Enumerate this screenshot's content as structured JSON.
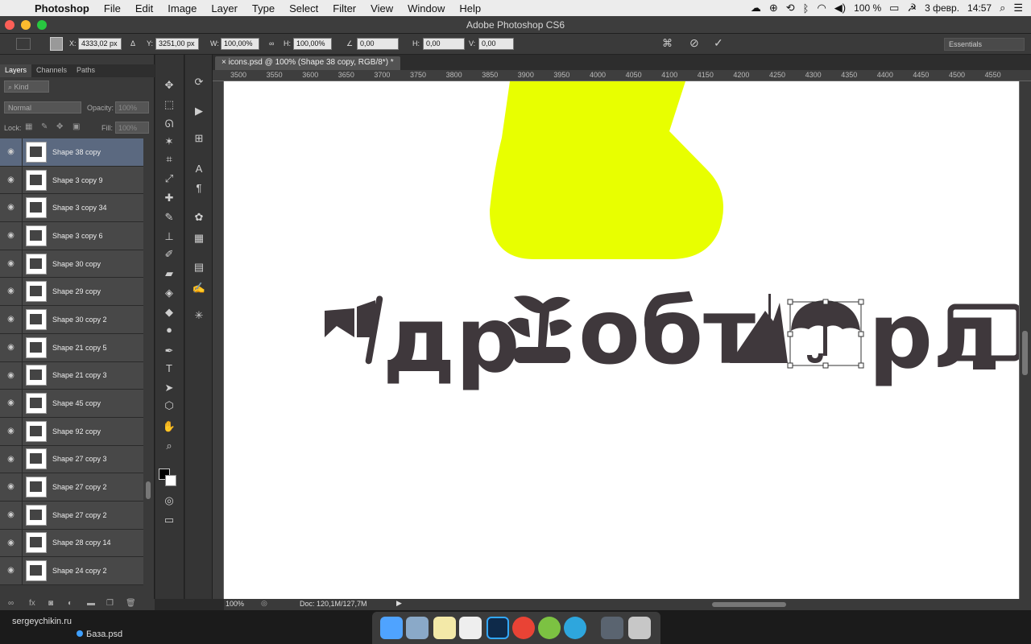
{
  "menubar": {
    "app": "Photoshop",
    "items": [
      "File",
      "Edit",
      "Image",
      "Layer",
      "Type",
      "Select",
      "Filter",
      "View",
      "Window",
      "Help"
    ],
    "battery": "100 %",
    "date": "3 февр.",
    "time": "14:57"
  },
  "window": {
    "title": "Adobe Photoshop CS6"
  },
  "options": {
    "x_label": "X:",
    "x_value": "4333,02 px",
    "y_label": "Y:",
    "y_value": "3251,00 px",
    "w_label": "W:",
    "w_value": "100,00%",
    "h_label": "H:",
    "h_value": "100,00%",
    "angle_value": "0,00",
    "hskew_label": "H:",
    "hskew_value": "0,00",
    "vskew_label": "V:",
    "vskew_value": "0,00",
    "workspace": "Essentials"
  },
  "panel": {
    "tabs": [
      "Layers",
      "Channels",
      "Paths"
    ],
    "kind": "Kind",
    "blend_mode": "Normal",
    "opacity_label": "Opacity:",
    "opacity_value": "100%",
    "lock_label": "Lock:",
    "fill_label": "Fill:",
    "fill_value": "100%"
  },
  "layers": [
    "Shape 38 copy",
    "Shape 3 copy 9",
    "Shape 3 copy 34",
    "Shape 3 copy 6",
    "Shape 30 copy",
    "Shape 29 copy",
    "Shape 30 copy 2",
    "Shape 21 copy 5",
    "Shape 21 copy 3",
    "Shape 45 copy",
    "Shape 92 copy",
    "Shape 27 copy 3",
    "Shape 27 copy 2",
    "Shape 27 copy 2",
    "Shape 28 copy 14",
    "Shape 24 copy 2"
  ],
  "document": {
    "tab": "icons.psd @ 100% (Shape 38 copy, RGB/8*) *",
    "text_a": "др",
    "text_b": "обт",
    "text_c": "рл"
  },
  "ruler": [
    "3500",
    "3550",
    "3600",
    "3650",
    "3700",
    "3750",
    "3800",
    "3850",
    "3900",
    "3950",
    "4000",
    "4050",
    "4100",
    "4150",
    "4200",
    "4250",
    "4300",
    "4350",
    "4400",
    "4450",
    "4500",
    "4550"
  ],
  "status": {
    "zoom": "100%",
    "doc": "Doc: 120,1M/127,7M"
  },
  "dock": {
    "site": "sergeychikin.ru",
    "file": "База.psd"
  },
  "colors": {
    "shape_fill": "#3f383c",
    "yellow": "#e8ff00",
    "selected_layer": "#5b6980"
  }
}
